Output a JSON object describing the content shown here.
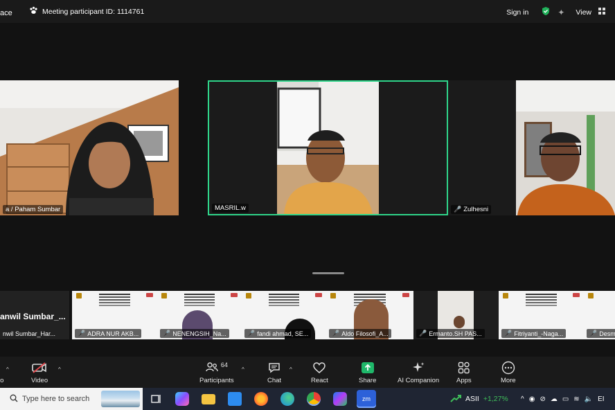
{
  "topbar": {
    "app_partial": "ace",
    "meeting_label": "Meeting participant ID: 1114761",
    "sign_in": "Sign in",
    "view": "View"
  },
  "gallery": {
    "tiles": [
      {
        "name": "a / Paham Sumbar",
        "muted": false
      },
      {
        "name": "MASRIL.w",
        "muted": false,
        "active_speaker": true
      },
      {
        "name": "Zulhesni",
        "muted": true
      }
    ]
  },
  "strip": {
    "text_tile": {
      "title": "anwil Sumbar_...",
      "name": "nwil Sumbar_Har..."
    },
    "thumbs": [
      {
        "name": "ADRA NUR AKB..."
      },
      {
        "name": "NENENGSIH_Na..."
      },
      {
        "name": "fandi ahmad, SE..."
      },
      {
        "name": "Aldo Filosofi_A..."
      },
      {
        "name": "Ermanto.SH PAS..."
      },
      {
        "name": "Fitriyanti_-Naga..."
      },
      {
        "name": "Desm"
      }
    ]
  },
  "toolbar": {
    "audio_partial": "io",
    "video": "Video",
    "participants": "Participants",
    "participants_count": "64",
    "chat": "Chat",
    "react": "React",
    "share": "Share",
    "ai_companion": "AI Companion",
    "apps": "Apps",
    "more": "More"
  },
  "taskbar": {
    "search_placeholder": "Type here to search",
    "stock_name": "ASII",
    "stock_change": "+1,27%",
    "stock_color": "#3fbf5a",
    "lang_partial": "EI"
  },
  "colors": {
    "active_border": "#2fd58a",
    "muted_red": "#e5484d",
    "share_green": "#1fb86a",
    "shield_green": "#20b15a"
  }
}
